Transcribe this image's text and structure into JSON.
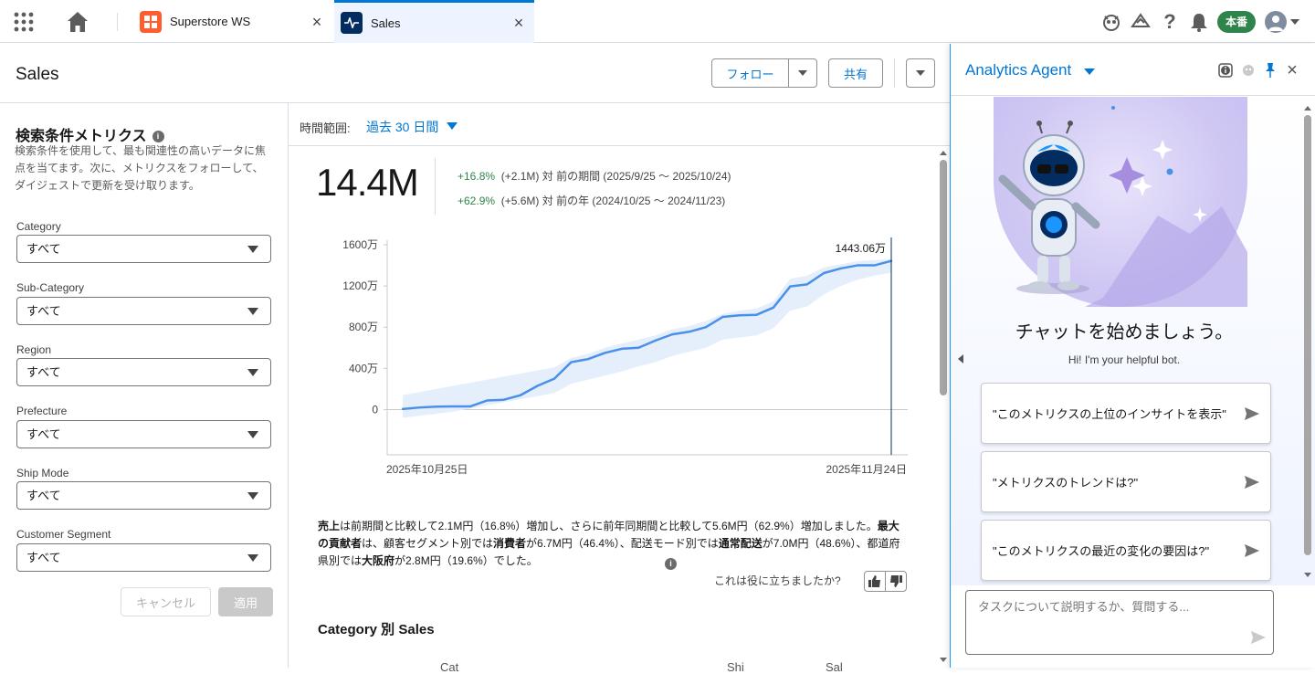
{
  "topbar": {
    "tabs": [
      {
        "label": "Superstore WS"
      },
      {
        "label": "Sales"
      }
    ],
    "env_badge": "本番"
  },
  "page": {
    "title": "Sales",
    "follow_label": "フォロー",
    "share_label": "共有"
  },
  "filters": {
    "title": "検索条件メトリクス",
    "description": "検索条件を使用して、最も関連性の高いデータに焦点を当てます。次に、メトリクスをフォローして、ダイジェストで更新を受け取ります。",
    "fields": [
      {
        "label": "Category",
        "value": "すべて"
      },
      {
        "label": "Sub-Category",
        "value": "すべて"
      },
      {
        "label": "Region",
        "value": "すべて"
      },
      {
        "label": "Prefecture",
        "value": "すべて"
      },
      {
        "label": "Ship Mode",
        "value": "すべて"
      },
      {
        "label": "Customer Segment",
        "value": "すべて"
      }
    ],
    "cancel_label": "キャンセル",
    "apply_label": "適用"
  },
  "main": {
    "time_label": "時間範囲:",
    "time_value": "過去 30 日間",
    "big_value": "14.4M",
    "delta1": {
      "pct": "+16.8%",
      "rest": "(+2.1M) 対 前の期間 (2025/9/25 〜 2025/10/24)"
    },
    "delta2": {
      "pct": "+62.9%",
      "rest": "(+5.6M) 対 前の年 (2024/10/25 〜 2024/11/23)"
    },
    "insight_html_parts": [
      {
        "b": "売上"
      },
      {
        "t": "は前期間と比較して2.1M円（16.8%）増加し、さらに前年同期間と比較して5.6M円（62.9%）増加しました。"
      },
      {
        "b": "最大の貢献者"
      },
      {
        "t": "は、顧客セグメント別では"
      },
      {
        "b": "消費者"
      },
      {
        "t": "が6.7M円（46.4%）、配送モード別では"
      },
      {
        "b": "通常配送"
      },
      {
        "t": "が7.0M円（48.6%）、都道府県別では"
      },
      {
        "b": "大阪府"
      },
      {
        "t": "が2.8M円（19.6%）でした。"
      }
    ],
    "feedback_label": "これは役に立ちましたか?",
    "section_title": "Category 別 Sales",
    "col_heads": [
      "Cat",
      "Shi",
      "Sal"
    ]
  },
  "chart_data": {
    "type": "line",
    "x": [
      "2025年10月25日",
      "",
      "",
      "",
      "",
      "",
      "",
      "",
      "",
      "",
      "",
      "",
      "",
      "",
      "",
      "",
      "",
      "",
      "",
      "",
      "",
      "",
      "",
      "",
      "",
      "",
      "",
      "",
      "",
      "2025年11月24日"
    ],
    "series": [
      {
        "values": [
          5,
          20,
          28,
          30,
          30,
          88,
          95,
          140,
          230,
          300,
          460,
          490,
          550,
          590,
          600,
          670,
          730,
          755,
          800,
          900,
          915,
          920,
          990,
          1195,
          1215,
          1325,
          1370,
          1400,
          1400,
          1443.06
        ]
      }
    ],
    "band_low": [
      -80,
      -60,
      -40,
      -20,
      10,
      40,
      70,
      100,
      130,
      160,
      250,
      290,
      330,
      370,
      420,
      460,
      520,
      560,
      600,
      680,
      700,
      720,
      790,
      960,
      1000,
      1120,
      1200,
      1260,
      1300,
      1330
    ],
    "band_high": [
      140,
      170,
      200,
      230,
      260,
      290,
      320,
      350,
      380,
      410,
      500,
      540,
      600,
      640,
      680,
      720,
      780,
      810,
      860,
      930,
      960,
      980,
      1050,
      1270,
      1300,
      1380,
      1410,
      1440,
      1450,
      1460
    ],
    "y_ticks": [
      "0",
      "400万",
      "800万",
      "1200万",
      "1600万"
    ],
    "ylim": [
      -200,
      1600
    ],
    "last_label": "1443.06万"
  },
  "agent": {
    "title": "Analytics Agent",
    "chat_start": "チャットを始めましょう。",
    "chat_sub": "Hi! I'm your helpful bot.",
    "suggestions": [
      "\"このメトリクスの上位のインサイトを表示\"",
      "\"メトリクスのトレンドは?\"",
      "\"このメトリクスの最近の変化の要因は?\""
    ],
    "input_placeholder": "タスクについて説明するか、質問する..."
  },
  "colors": {
    "accent": "#0176d3",
    "line": "#4a90e8",
    "band": "#e5effc",
    "positive": "#2e844a"
  }
}
